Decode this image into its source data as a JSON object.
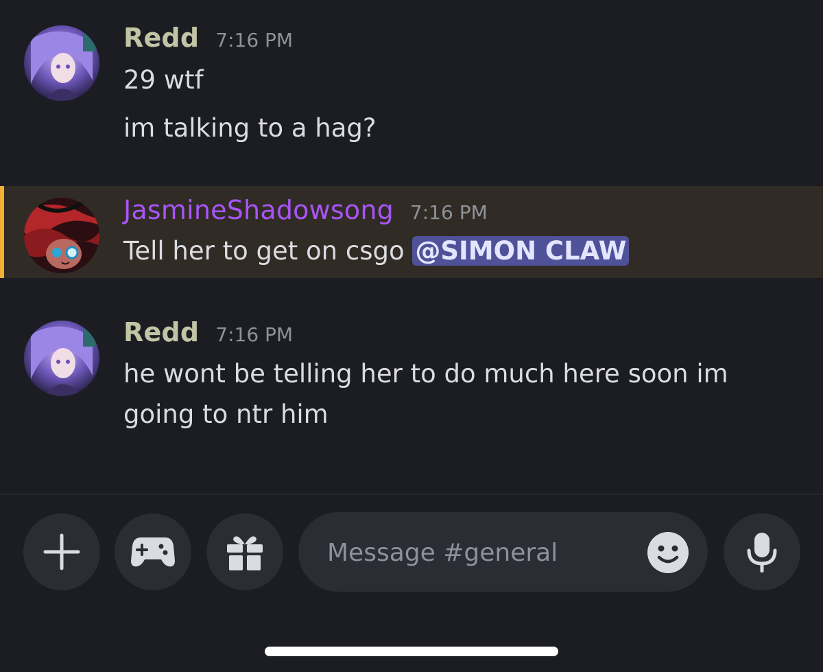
{
  "channel": {
    "name": "#general"
  },
  "messages": [
    {
      "author": "Redd",
      "author_color": "#c2c4a6",
      "time": "7:16 PM",
      "avatar": "anime-girl-purple-hair-avatar",
      "lines": [
        "29 wtf",
        "im talking to a hag?"
      ]
    },
    {
      "author": "JasmineShadowsong",
      "author_color": "#a855f7",
      "time": "7:16 PM",
      "avatar": "red-black-swirl-character-avatar",
      "highlighted": true,
      "text": "Tell her to get on csgo ",
      "mention": "@SIMON CLAW"
    },
    {
      "author": "Redd",
      "author_color": "#c2c4a6",
      "time": "7:16 PM",
      "avatar": "anime-girl-purple-hair-avatar",
      "lines": [
        "he wont be telling her to do much here soon im",
        "going to ntr him"
      ]
    }
  ],
  "composer": {
    "placeholder": "Message #general",
    "buttons": [
      "plus-icon",
      "gamepad-icon",
      "gift-icon",
      "emoji-icon",
      "microphone-icon"
    ]
  },
  "colors": {
    "background": "#1c1d22",
    "button_bg": "#2b2d35",
    "highlight_bg": "#312b25",
    "highlight_bar": "#f0b232",
    "mention_bg": "#4f5299"
  }
}
